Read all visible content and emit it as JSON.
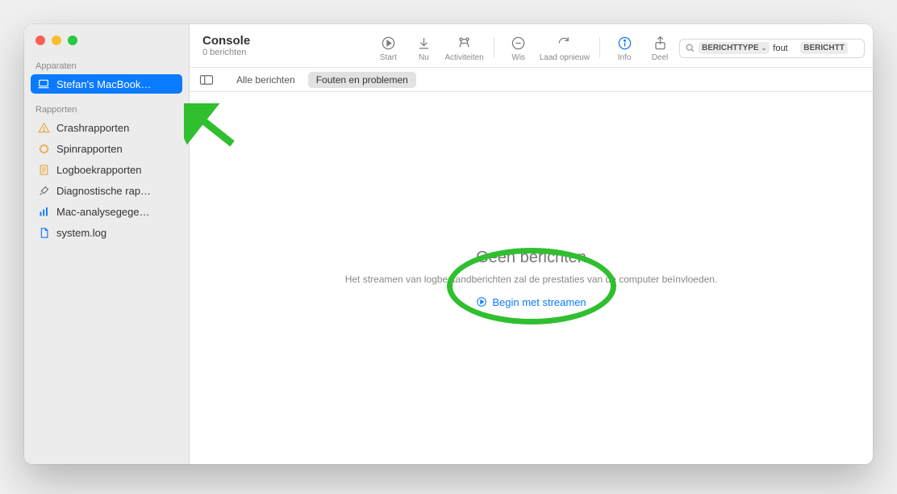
{
  "window": {
    "title": "Console",
    "subtitle": "0 berichten"
  },
  "toolbar": {
    "start": "Start",
    "now": "Nu",
    "activities": "Activiteiten",
    "clear": "Wis",
    "reload": "Laad opnieuw",
    "info": "Info",
    "share": "Deel"
  },
  "search": {
    "type_token": "BERICHTTYPE",
    "value": "fout",
    "trailing_token": "BERICHTT"
  },
  "sidebar": {
    "devices_label": "Apparaten",
    "device_name": "Stefan's MacBook…",
    "reports_label": "Rapporten",
    "reports": [
      {
        "label": "Crashrapporten"
      },
      {
        "label": "Spinrapporten"
      },
      {
        "label": "Logboekrapporten"
      },
      {
        "label": "Diagnostische rap…"
      },
      {
        "label": "Mac-analysegege…"
      },
      {
        "label": "system.log"
      }
    ]
  },
  "filterbar": {
    "all": "Alle berichten",
    "errors": "Fouten en problemen"
  },
  "empty": {
    "title": "Geen berichten",
    "subtitle": "Het streamen van logbestandberichten zal de prestaties van de computer beïnvloeden.",
    "link": "Begin met streamen"
  }
}
